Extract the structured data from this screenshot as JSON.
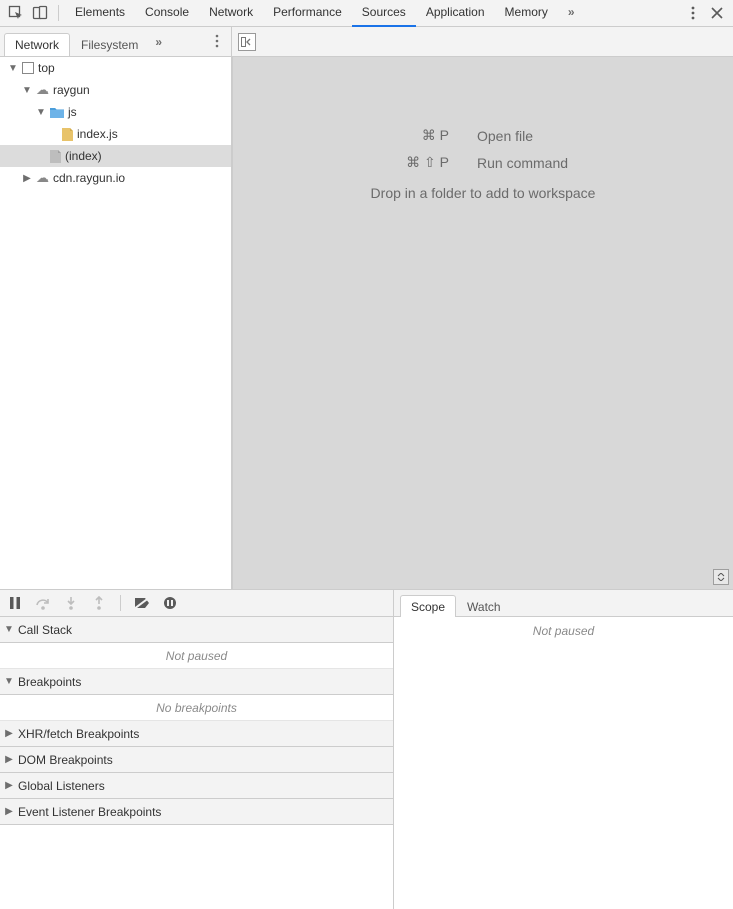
{
  "topTabs": {
    "elements": "Elements",
    "console": "Console",
    "network": "Network",
    "performance": "Performance",
    "sources": "Sources",
    "application": "Application",
    "memory": "Memory"
  },
  "sourcesTabs": {
    "network": "Network",
    "filesystem": "Filesystem"
  },
  "tree": {
    "top": "top",
    "raygun": "raygun",
    "js": "js",
    "indexjs": "index.js",
    "index": "(index)",
    "cdn": "cdn.raygun.io"
  },
  "hints": {
    "openKey": "⌘ P",
    "openLbl": "Open file",
    "runKey": "⌘ ⇧ P",
    "runLbl": "Run command",
    "drop": "Drop in a folder to add to workspace"
  },
  "dbgTabs": {
    "scope": "Scope",
    "watch": "Watch"
  },
  "panels": {
    "callstack": "Call Stack",
    "callstackEmpty": "Not paused",
    "breakpoints": "Breakpoints",
    "breakpointsEmpty": "No breakpoints",
    "xhr": "XHR/fetch Breakpoints",
    "dom": "DOM Breakpoints",
    "global": "Global Listeners",
    "event": "Event Listener Breakpoints",
    "scopeEmpty": "Not paused"
  }
}
